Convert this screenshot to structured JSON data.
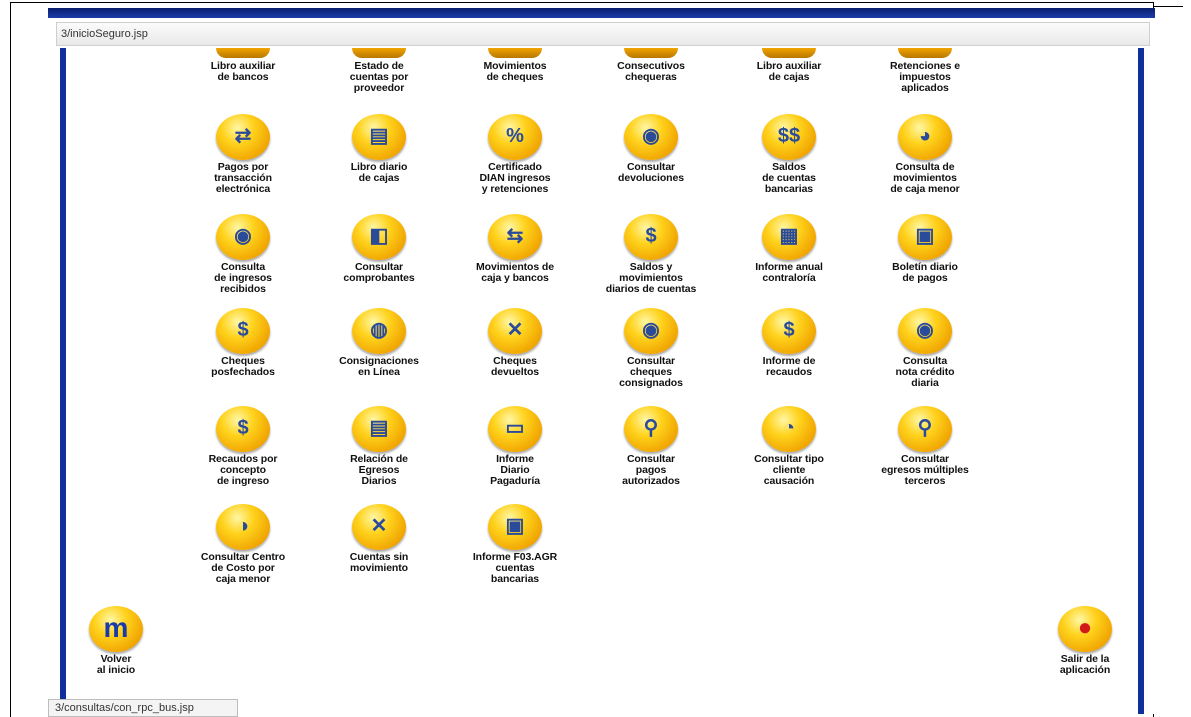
{
  "url": "3/inicioSeguro.jsp",
  "status_url": "3/consultas/con_rpc_bus.jsp",
  "rows": [
    [
      {
        "name": "libro-auxiliar-bancos",
        "label": "Libro auxiliar\nde bancos",
        "icon": "bank-book-icon",
        "glyph": ""
      },
      {
        "name": "estado-cuentas-proveedor",
        "label": "Estado de\ncuentas por\nproveedor",
        "icon": "supplier-account-icon",
        "glyph": ""
      },
      {
        "name": "movimientos-cheques",
        "label": "Movimientos\nde cheques",
        "icon": "checks-movement-icon",
        "glyph": ""
      },
      {
        "name": "consecutivos-chequeras",
        "label": "Consecutivos\nchequeras",
        "icon": "checkbook-icon",
        "glyph": ""
      },
      {
        "name": "libro-auxiliar-cajas",
        "label": "Libro auxiliar\nde cajas",
        "icon": "cash-book-icon",
        "glyph": ""
      },
      {
        "name": "retenciones-impuestos",
        "label": "Retenciones e\nimpuestos\naplicados",
        "icon": "tax-icon",
        "glyph": ""
      }
    ],
    [
      {
        "name": "pagos-transaccion-electronica",
        "label": "Pagos por\ntransacción\nelectrónica",
        "icon": "electronic-payment-icon",
        "glyph": "⇄"
      },
      {
        "name": "libro-diario-cajas",
        "label": "Libro diario\nde cajas",
        "icon": "cash-register-icon",
        "glyph": "▤"
      },
      {
        "name": "certificado-dian",
        "label": "Certificado\nDIAN ingresos\ny retenciones",
        "icon": "certificate-icon",
        "glyph": "%"
      },
      {
        "name": "consultar-devoluciones",
        "label": "Consultar\ndevoluciones",
        "icon": "refund-search-icon",
        "glyph": "◉"
      },
      {
        "name": "saldos-cuentas-bancarias",
        "label": "Saldos\nde cuentas\nbancarias",
        "icon": "bank-balance-icon",
        "glyph": "$$"
      },
      {
        "name": "consulta-movimientos-caja-menor",
        "label": "Consulta de\nmovimientos\nde caja menor",
        "icon": "petty-cash-search-icon",
        "glyph": "◕"
      }
    ],
    [
      {
        "name": "consulta-ingresos-recibidos",
        "label": "Consulta\nde ingresos\nrecibidos",
        "icon": "income-search-icon",
        "glyph": "◉"
      },
      {
        "name": "consultar-comprobantes",
        "label": "Consultar\ncomprobantes",
        "icon": "voucher-search-icon",
        "glyph": "◧"
      },
      {
        "name": "movimientos-caja-bancos",
        "label": "Movimientos de\ncaja y bancos",
        "icon": "cash-bank-movement-icon",
        "glyph": "⇆"
      },
      {
        "name": "saldos-movimientos-diarios",
        "label": "Saldos y\nmovimientos\ndiarios de cuentas",
        "icon": "daily-balance-icon",
        "glyph": "$"
      },
      {
        "name": "informe-anual-contraloria",
        "label": "Informe anual\ncontraloría",
        "icon": "annual-report-icon",
        "glyph": "▦"
      },
      {
        "name": "boletin-diario-pagos",
        "label": "Boletín diario\nde pagos",
        "icon": "daily-bulletin-icon",
        "glyph": "▣"
      }
    ],
    [
      {
        "name": "cheques-posfechados",
        "label": "Cheques\nposfechados",
        "icon": "postdated-check-icon",
        "glyph": "$"
      },
      {
        "name": "consignaciones-en-linea",
        "label": "Consignaciones\nen Línea",
        "icon": "online-deposit-icon",
        "glyph": "◍"
      },
      {
        "name": "cheques-devueltos",
        "label": "Cheques\ndevueltos",
        "icon": "returned-check-icon",
        "glyph": "✕"
      },
      {
        "name": "consultar-cheques-consignados",
        "label": "Consultar\ncheques\nconsignados",
        "icon": "deposited-check-search-icon",
        "glyph": "◉"
      },
      {
        "name": "informe-recaudos",
        "label": "Informe de\nrecaudos",
        "icon": "collections-report-icon",
        "glyph": "$"
      },
      {
        "name": "consulta-nota-credito-diaria",
        "label": "Consulta\nnota crédito\ndiaria",
        "icon": "credit-note-search-icon",
        "glyph": "◉"
      }
    ],
    [
      {
        "name": "recaudos-concepto-ingreso",
        "label": "Recaudos por\nconcepto\nde ingreso",
        "icon": "collection-concept-icon",
        "glyph": "$"
      },
      {
        "name": "relacion-egresos-diarios",
        "label": "Relación de\nEgresos\nDiarios",
        "icon": "daily-expenses-icon",
        "glyph": "▤"
      },
      {
        "name": "informe-diario-pagaduria",
        "label": "Informe\nDiario\nPagaduría",
        "icon": "payroll-report-icon",
        "glyph": "▭"
      },
      {
        "name": "consultar-pagos-autorizados",
        "label": "Consultar\npagos\nautorizados",
        "icon": "authorized-payment-search-icon",
        "glyph": "⚲"
      },
      {
        "name": "consultar-tipo-cliente-causacion",
        "label": "Consultar tipo\ncliente\ncausación",
        "icon": "client-type-search-icon",
        "glyph": "◔"
      },
      {
        "name": "consultar-egresos-multiples-terceros",
        "label": "Consultar\negresos múltiples\nterceros",
        "icon": "multiple-third-party-icon",
        "glyph": "⚲"
      }
    ],
    [
      {
        "name": "consultar-centro-costo-caja-menor",
        "label": "Consultar Centro\nde Costo por\ncaja menor",
        "icon": "cost-center-search-icon",
        "glyph": "◑"
      },
      {
        "name": "cuentas-sin-movimiento",
        "label": "Cuentas sin\nmovimiento",
        "icon": "inactive-accounts-icon",
        "glyph": "✕"
      },
      {
        "name": "informe-f03-agr",
        "label": "Informe F03.AGR\ncuentas\nbancarias",
        "icon": "bank-accounts-report-icon",
        "glyph": "▣"
      }
    ]
  ],
  "footer": {
    "back_label": "Volver\nal inicio",
    "back_glyph": "m",
    "exit_label": "Salir de la\naplicación",
    "exit_glyph": "●"
  }
}
